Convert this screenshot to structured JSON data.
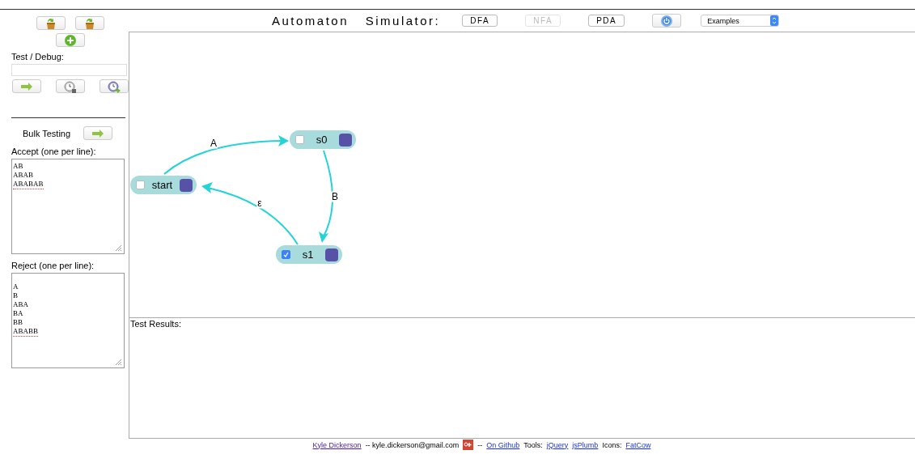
{
  "title": "Automaton Simulator:",
  "modes": [
    {
      "label": "DFA",
      "disabled": false
    },
    {
      "label": "NFA",
      "disabled": true
    },
    {
      "label": "PDA",
      "disabled": false
    }
  ],
  "examples": {
    "value": "Examples"
  },
  "sidebar": {
    "test_label": "Test / Debug:",
    "bulk_label": "Bulk Testing",
    "accept": {
      "label": "Accept (one per line):",
      "lines": [
        "AB",
        "ABAB",
        "ABABAB"
      ]
    },
    "reject": {
      "label": "Reject (one per line):",
      "lines": [
        "A",
        "B",
        "ABA",
        "BA",
        "BB",
        "ABABB"
      ]
    }
  },
  "states": [
    {
      "name": "start",
      "accepting": false
    },
    {
      "name": "s0",
      "accepting": false
    },
    {
      "name": "s1",
      "accepting": true
    }
  ],
  "transitions": [
    {
      "label": "A"
    },
    {
      "label": "B"
    },
    {
      "label": "ε"
    }
  ],
  "results": {
    "label": "Test Results:"
  },
  "footer": [
    {
      "kind": "link",
      "text": "Kyle Dickerson"
    },
    {
      "kind": "text",
      "text": "-- kyle.dickerson@gmail.com"
    },
    {
      "kind": "icon"
    },
    {
      "kind": "text",
      "text": "--"
    },
    {
      "kind": "link",
      "text": "On Github"
    },
    {
      "kind": "text",
      "text": "Tools:"
    },
    {
      "kind": "link",
      "text": "jQuery"
    },
    {
      "kind": "link",
      "text": "jsPlumb"
    },
    {
      "kind": "text",
      "text": "Icons:"
    },
    {
      "kind": "link",
      "text": "FatCow"
    }
  ]
}
